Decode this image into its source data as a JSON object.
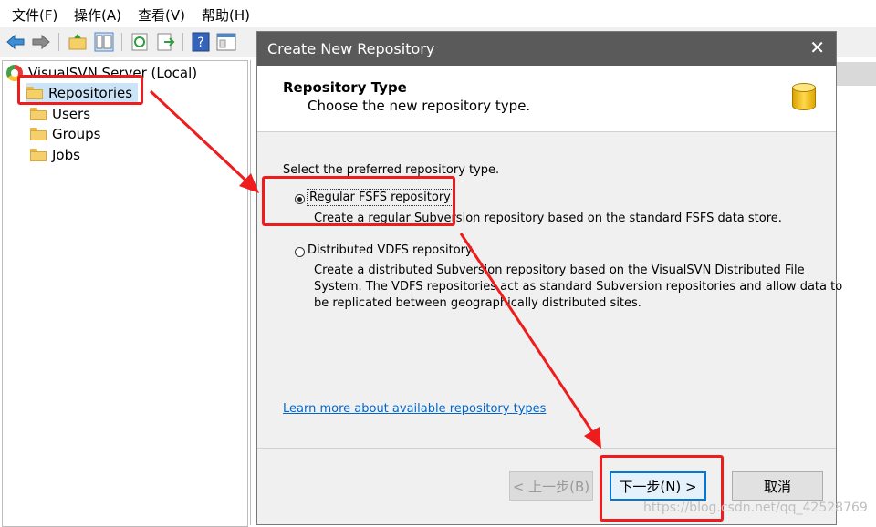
{
  "menu": [
    "文件(F)",
    "操作(A)",
    "查看(V)",
    "帮助(H)"
  ],
  "tree": {
    "root": "VisualSVN Server (Local)",
    "items": [
      "Repositories",
      "Users",
      "Groups",
      "Jobs"
    ]
  },
  "dialog": {
    "title": "Create New Repository",
    "close": "✕",
    "header_title": "Repository Type",
    "header_subtitle": "Choose the new repository type.",
    "prompt": "Select the preferred repository type.",
    "options": [
      {
        "label": "Regular FSFS repository",
        "description_lines": [
          "Create a regular Subversion repository based on the standard FSFS data store."
        ],
        "selected": true
      },
      {
        "label": "Distributed VDFS repository",
        "description_lines": [
          "Create a distributed Subversion repository based on the VisualSVN Distributed File",
          "System. The VDFS repositories act as standard Subversion repositories and allow data to",
          "be replicated between geographically distributed sites."
        ],
        "selected": false
      }
    ],
    "learn_more": "Learn more about available repository types",
    "buttons": {
      "back": "< 上一步(B)",
      "next": "下一步(N) >",
      "cancel": "取消"
    }
  },
  "watermark": "https://blog.csdn.net/qq_42528769",
  "colors": {
    "annotation": "#ee1c1c",
    "title_bar": "#5a5a5a",
    "link": "#0066cc",
    "selection": "#cce4f7"
  }
}
